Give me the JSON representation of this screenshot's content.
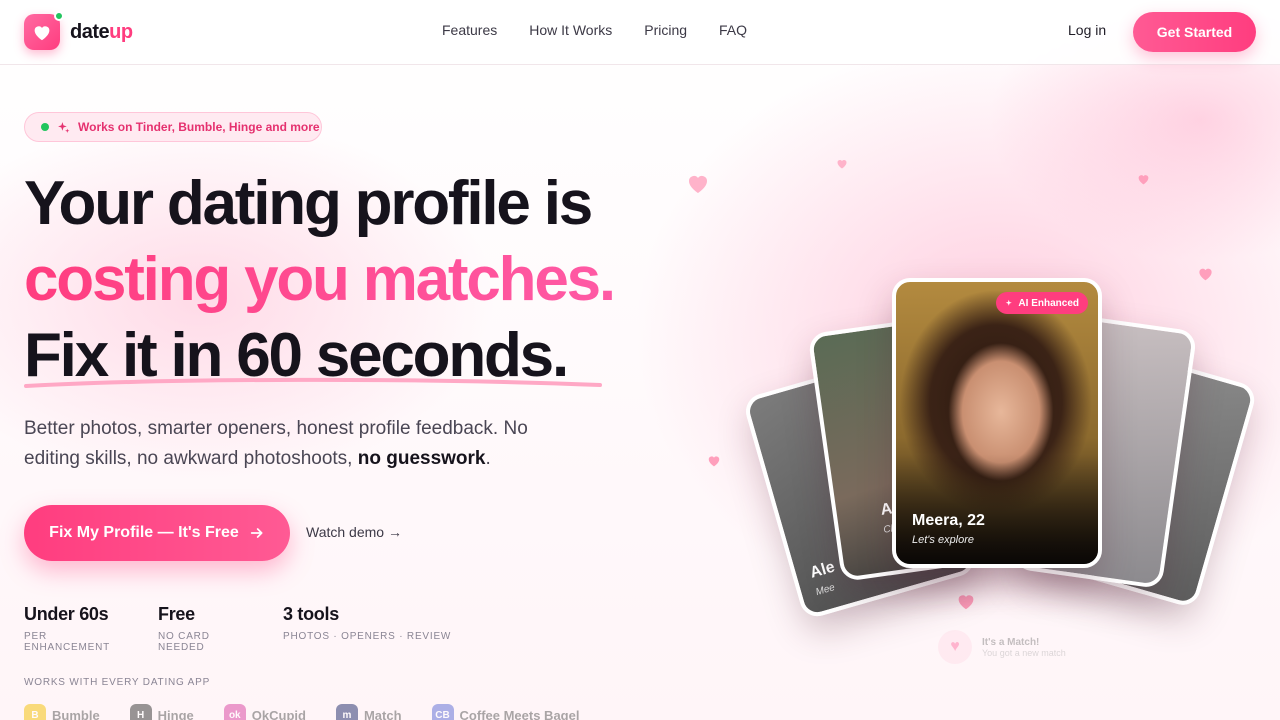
{
  "nav": {
    "logo_main": "date",
    "logo_accent": "up",
    "links": [
      "Features",
      "How It Works",
      "Pricing",
      "FAQ"
    ],
    "login": "Log in",
    "cta": "Get Started"
  },
  "hero": {
    "pill": "Works on Tinder, Bumble, Hinge and more",
    "line1": "Your dating profile is",
    "line2": "costing you matches.",
    "line3": "Fix it in 60 seconds.",
    "sub_text": "Better photos, smarter openers, honest profile feedback. No editing skills, no awkward photoshoots,",
    "sub_bold": "no guesswork",
    "sub_end": ".",
    "cta": "Fix My Profile — It's Free",
    "watch": "Watch demo →"
  },
  "stats": [
    {
      "value": "Under 60s",
      "label": "PER ENHANCEMENT"
    },
    {
      "value": "Free",
      "label": "NO CARD NEEDED"
    },
    {
      "value": "3 tools",
      "label": "PHOTOS · OPENERS · REVIEW"
    }
  ],
  "works_with": {
    "label": "WORKS WITH EVERY DATING APP",
    "apps": [
      {
        "name": "Bumble",
        "color": "#f5c000"
      },
      {
        "name": "Hinge",
        "color": "#333333"
      },
      {
        "name": "OkCupid",
        "color": "#d93fa0"
      },
      {
        "name": "Match",
        "color": "#1d2a6b"
      },
      {
        "name": "Coffee Meets Bagel",
        "color": "#5b6bd6"
      }
    ]
  },
  "cards": {
    "main_name": "Meera, 22",
    "main_tagline": "Let's explore",
    "badge": "AI Enhanced",
    "left_name_1": "Ana",
    "left_sub_1": "Chai ov",
    "left_name_2": "Ale",
    "left_sub_2": "Mee"
  },
  "match": {
    "title": "It's a Match!",
    "sub": "You got a new match"
  },
  "colors": {
    "accent": "#ff3d7f",
    "green": "#22c55e",
    "text": "#16131c"
  }
}
